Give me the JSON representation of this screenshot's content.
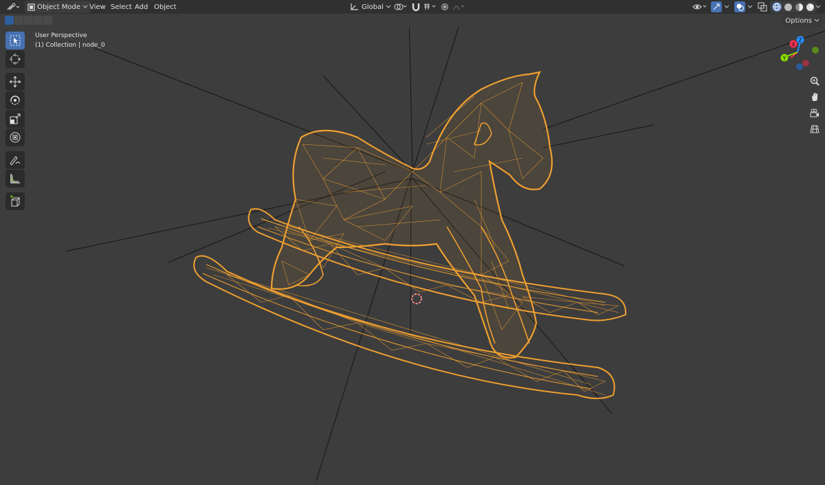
{
  "header": {
    "mode_label": "Object Mode",
    "menus": [
      "View",
      "Select",
      "Add",
      "Object"
    ],
    "transform_orientation": "Global"
  },
  "viewport": {
    "options_label": "Options",
    "perspective_label": "User Perspective",
    "collection_label": "(1) Collection | node_0"
  },
  "gizmo": {
    "axes": [
      "X",
      "Y",
      "Z"
    ],
    "colors": {
      "x": "#ff3352",
      "y": "#8bdc00",
      "z": "#2890ff"
    }
  },
  "toolbar": {
    "tools": [
      "select-box",
      "cursor",
      "move",
      "rotate",
      "scale",
      "transform",
      "annotate",
      "measure",
      "add-cube"
    ]
  },
  "colors": {
    "background": "#3d3d3d",
    "header": "#303030",
    "accent": "#4772b3",
    "selection": "#f0a030"
  }
}
